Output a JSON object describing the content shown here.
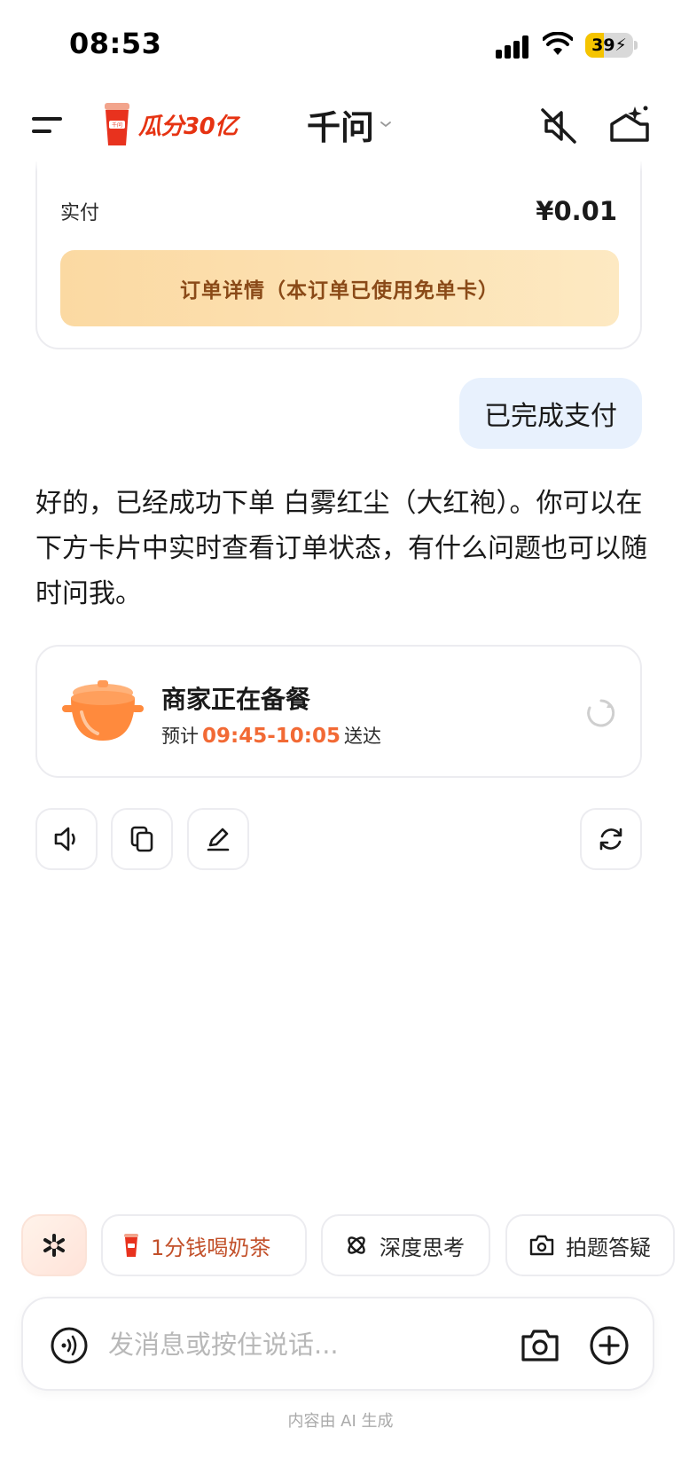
{
  "status_bar": {
    "time": "08:53",
    "battery": "39",
    "battery_level_percent": 39
  },
  "nav": {
    "promo_text": "瓜分30亿",
    "title": "千问",
    "icons": [
      "menu-icon",
      "mute-icon",
      "new-chat-icon"
    ]
  },
  "order_card": {
    "paid_label": "实付",
    "paid_amount": "¥0.01",
    "detail_button": "订单详情（本订单已使用免单卡）"
  },
  "user_message": "已完成支付",
  "ai_reply": "好的，已经成功下单 白雾红尘（大红袍）。你可以在下方卡片中实时查看订单状态，有什么问题也可以随时问我。",
  "delivery_card": {
    "status": "商家正在备餐",
    "eta_prefix": "预计",
    "eta_time": "09:45-10:05",
    "eta_suffix": "送达"
  },
  "actions": [
    "speaker-icon",
    "copy-icon",
    "edit-icon",
    "regenerate-icon"
  ],
  "chips": [
    {
      "label": "1分钱喝奶茶",
      "icon": "milk-tea-cup-icon"
    },
    {
      "label": "深度思考",
      "icon": "deep-think-icon"
    },
    {
      "label": "拍题答疑",
      "icon": "camera-question-icon"
    }
  ],
  "input": {
    "placeholder": "发消息或按住说话..."
  },
  "footnote": "内容由 AI 生成",
  "colors": {
    "accent_orange": "#f26a35",
    "promo_red": "#e63312",
    "user_bubble": "#e8f1fd",
    "order_button": "#fbd9a2"
  }
}
